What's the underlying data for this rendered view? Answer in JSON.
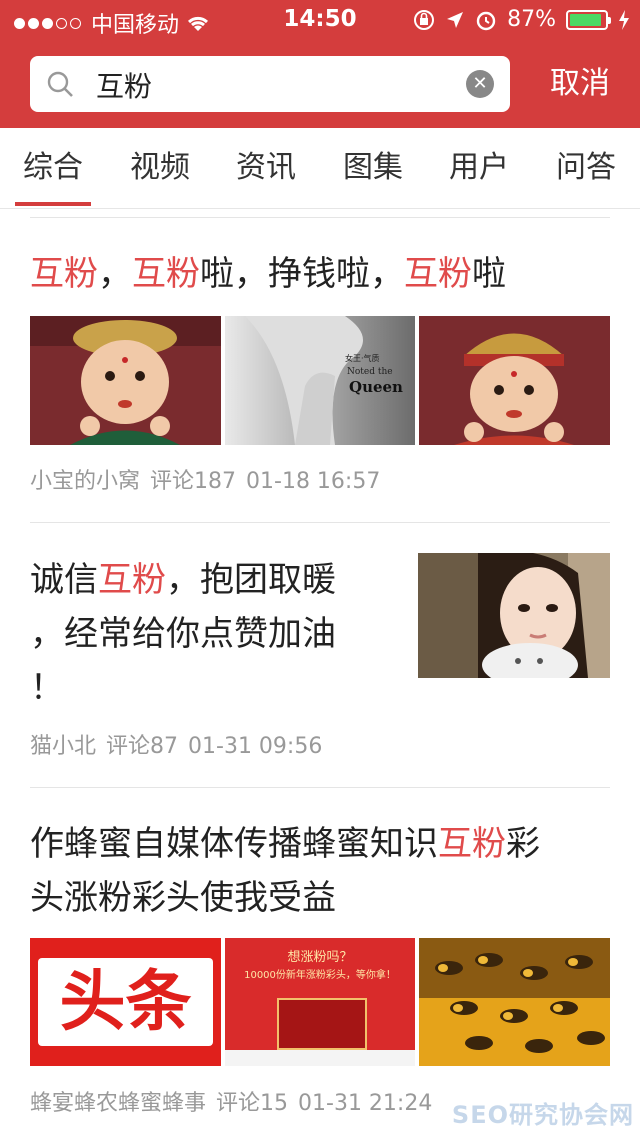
{
  "status_bar": {
    "carrier": "中国移动",
    "time": "14:50",
    "battery": "87%",
    "battery_level": 0.87,
    "signal_dots_on": 3,
    "signal_dots_total": 5
  },
  "search": {
    "query": "互粉",
    "cancel_label": "取消"
  },
  "tabs": [
    {
      "label": "综合",
      "active": true
    },
    {
      "label": "视频",
      "active": false
    },
    {
      "label": "资讯",
      "active": false
    },
    {
      "label": "图集",
      "active": false
    },
    {
      "label": "用户",
      "active": false
    },
    {
      "label": "问答",
      "active": false
    }
  ],
  "articles": [
    {
      "title_parts": [
        [
          "互粉",
          true
        ],
        [
          "，",
          false
        ],
        [
          "互粉",
          true
        ],
        [
          "啦，挣钱啦，",
          false
        ],
        [
          "互粉",
          true
        ],
        [
          "啦",
          false
        ]
      ],
      "source": "小宝的小窝",
      "comments": "评论187",
      "time": "01-18 16:57",
      "thumbnail_text": "女王·气质 Noted the Queen"
    },
    {
      "title_line1": [
        "诚信",
        "互粉",
        "，抱团取暖"
      ],
      "title_line2": "，经常给你点赞加油",
      "title_line3": "！",
      "source": "猫小北",
      "comments": "评论87",
      "time": "01-31 09:56"
    },
    {
      "title_line1": [
        "作蜂蜜自媒体传播蜂蜜知识",
        "互粉",
        "彩"
      ],
      "title_line2": "头涨粉彩头使我受益",
      "source": "蜂宴蜂农蜂蜜蜂事",
      "comments": "评论15",
      "time": "01-31 21:24",
      "thumbnail_texts": [
        "头条",
        "想涨粉吗？",
        "10000份新年涨粉彩头，等你拿！"
      ]
    }
  ],
  "watermark": "SEO研究协会网",
  "colors": {
    "brand_red": "#d43d3d",
    "highlight": "#e04b4b",
    "meta_gray": "#999999"
  }
}
